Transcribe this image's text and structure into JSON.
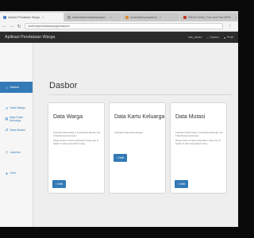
{
  "browser": {
    "tabs": [
      {
        "label": "Aplikasi Pendataan Warga",
        "color": "#4f7fc4",
        "active": true
      },
      {
        "label": "localhost/pendataan/pages/...",
        "color": "#9a9a9a",
        "active": false
      },
      {
        "label": "localhost/phpmyadmin",
        "color": "#e08a2e",
        "active": false
      },
      {
        "label": "MEGA Online | Free and Fast WEB...",
        "color": "#c0392b",
        "active": false
      }
    ],
    "url": "localhost/pendataan/pages/dasbor/",
    "back_icon": "back-arrow-icon",
    "forward_icon": "forward-arrow-icon",
    "reload_icon": "reload-icon"
  },
  "app": {
    "brand": "Aplikasi Pendataan Warga",
    "user": "hak_akses",
    "dasbor_link": "Dasbor",
    "profil_link": "Profil"
  },
  "sidebar": {
    "items": [
      {
        "label": "Dasbor",
        "icon": "home-icon",
        "active": true
      },
      {
        "label": "Data Warga",
        "icon": "list-icon",
        "active": false
      },
      {
        "label": "Data Kartu Keluarga",
        "icon": "id-card-icon",
        "active": false
      },
      {
        "label": "Data Mutasi",
        "icon": "exchange-icon",
        "active": false
      },
      {
        "label": "Laporan",
        "icon": "file-icon",
        "active": false
      },
      {
        "label": "User",
        "icon": "user-icon",
        "active": false
      }
    ]
  },
  "page": {
    "title": "Dasbor",
    "panels": [
      {
        "title": "Data Warga",
        "text": [
          "Total ada 2 data warga, 0 di antaranya laki-laki, dan 0 diantaranya perempuan",
          "Warga di atas 17 tahun berjumlah 0 orang, dan di bawah 17 tahun berjumlah 0 orang"
        ],
        "button": "Detil"
      },
      {
        "title": "Data Kartu Keluarga",
        "text": [
          "Total ada 0 data kartu keluarga"
        ],
        "button": "Detil"
      },
      {
        "title": "Data Mutasi",
        "text": [
          "Total ada 0 data mutasi, 0 di antaranya laki-laki, dan 0 diantaranya perempuan",
          "Warga di atas 17 tahun berjumlah 0 orang, dan di bawah 17 tahun berjumlah 0 orang"
        ],
        "button": "Detil"
      }
    ]
  },
  "colors": {
    "primary": "#337ab7",
    "navbar": "#2b2b2b"
  }
}
